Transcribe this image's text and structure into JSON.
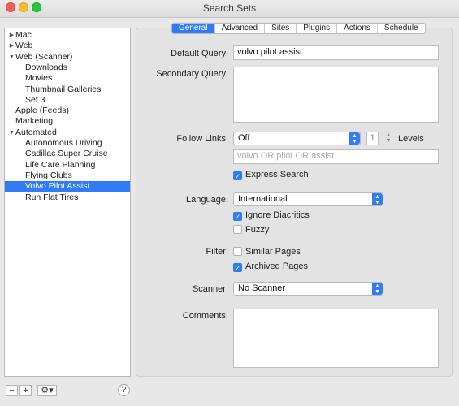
{
  "window": {
    "title": "Search Sets"
  },
  "sidebar": {
    "items": [
      {
        "label": "Mac",
        "expander": "▶"
      },
      {
        "label": "Web",
        "expander": "▶"
      },
      {
        "label": "Web (Scanner)",
        "expander": "▼"
      },
      {
        "label": "Downloads"
      },
      {
        "label": "Movies"
      },
      {
        "label": "Thumbnail Galleries"
      },
      {
        "label": "Set 3"
      },
      {
        "label": "Apple (Feeds)"
      },
      {
        "label": "Marketing"
      },
      {
        "label": "Automated",
        "expander": "▼"
      },
      {
        "label": "Autonomous Driving"
      },
      {
        "label": "Cadillac Super Cruise"
      },
      {
        "label": "Life Care Planning"
      },
      {
        "label": "Flying Clubs"
      },
      {
        "label": "Volvo Pilot Assist",
        "selected": true
      },
      {
        "label": "Run Flat Tires"
      }
    ],
    "remove_label": "−",
    "add_label": "+",
    "action_label": "⚙▾",
    "help_label": "?"
  },
  "tabs": [
    "General",
    "Advanced",
    "Sites",
    "Plugins",
    "Actions",
    "Schedule"
  ],
  "form": {
    "default_query_label": "Default Query:",
    "default_query_value": "volvo pilot assist",
    "secondary_query_label": "Secondary Query:",
    "secondary_query_value": "",
    "follow_links_label": "Follow Links:",
    "follow_links_value": "Off",
    "levels_value": "1",
    "levels_label": "Levels",
    "expanded_query_preview": "volvo OR pilot OR assist",
    "express_search_label": "Express Search",
    "language_label": "Language:",
    "language_value": "International",
    "ignore_diacritics_label": "Ignore Diacritics",
    "fuzzy_label": "Fuzzy",
    "filter_label": "Filter:",
    "similar_pages_label": "Similar Pages",
    "archived_pages_label": "Archived Pages",
    "scanner_label": "Scanner:",
    "scanner_value": "No Scanner",
    "comments_label": "Comments:",
    "comments_value": ""
  },
  "checks": {
    "express_search": true,
    "ignore_diacritics": true,
    "fuzzy": false,
    "similar_pages": false,
    "archived_pages": true
  },
  "colors": {
    "accent": "#2f7cf6"
  }
}
